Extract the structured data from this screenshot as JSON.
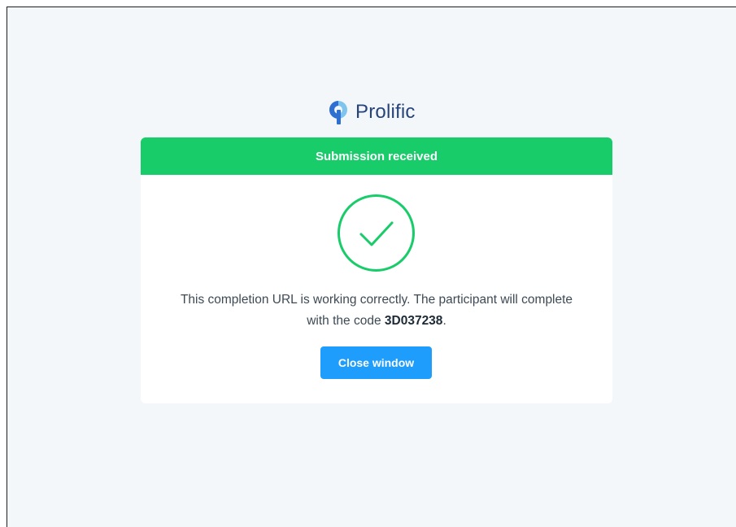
{
  "brand": {
    "name": "Prolific",
    "logo_icon": "prolific-logo-icon",
    "color": "#26437a"
  },
  "card": {
    "header_title": "Submission received",
    "header_color": "#18cc69",
    "status_icon": "checkmark-circle-icon",
    "message_part1": "This completion URL is working correctly. The participant will complete with the code ",
    "completion_code": "3D037238",
    "message_part2": ".",
    "close_button_label": "Close window",
    "button_color": "#1e9dfc"
  }
}
